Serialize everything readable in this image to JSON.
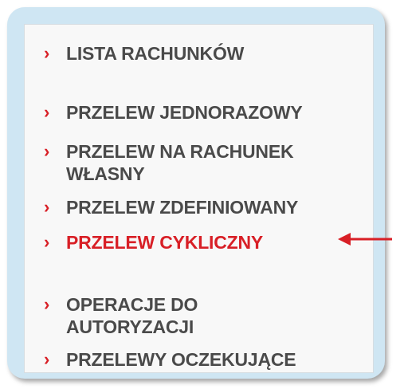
{
  "menu": {
    "items": [
      {
        "label": "LISTA RACHUNKÓW",
        "active": false
      },
      {
        "label": "PRZELEW JEDNORAZOWY",
        "active": false
      },
      {
        "label": "PRZELEW NA RACHUNEK\nWŁASNY",
        "active": false
      },
      {
        "label": "PRZELEW ZDEFINIOWANY",
        "active": false
      },
      {
        "label": "PRZELEW CYKLICZNY",
        "active": true
      },
      {
        "label": "OPERACJE DO\nAUTORYZACJI",
        "active": false
      },
      {
        "label": "PRZELEWY OCZEKUJĄCE",
        "active": false
      }
    ],
    "bullet_glyph": "›"
  },
  "annotation": {
    "arrow_color": "#d81f26",
    "points_to": "PRZELEW CYKLICZNY"
  },
  "colors": {
    "frame": "#cfe6f3",
    "panel": "#f8f8f8",
    "text": "#4a4a4a",
    "accent": "#d81f26"
  }
}
